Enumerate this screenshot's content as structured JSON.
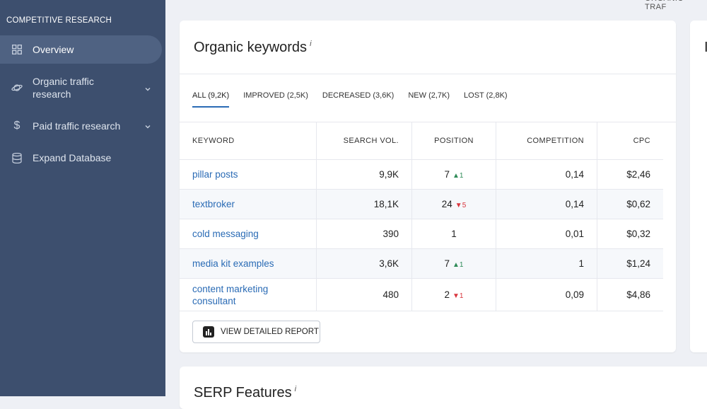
{
  "top_hint": "ORGANIC TRAF",
  "sidebar": {
    "section_title": "COMPETITIVE RESEARCH",
    "items": [
      {
        "label": "Overview",
        "icon": "grid-icon",
        "active": true
      },
      {
        "label": "Organic traffic research",
        "icon": "planet-icon",
        "chevron": true
      },
      {
        "label": "Paid traffic research",
        "icon": "dollar-icon",
        "chevron": true
      },
      {
        "label": "Expand Database",
        "icon": "database-icon"
      }
    ]
  },
  "keywords_card": {
    "title": "Organic keywords",
    "info": "i",
    "tabs": [
      {
        "label": "ALL (9,2K)",
        "active": true
      },
      {
        "label": "IMPROVED (2,5K)"
      },
      {
        "label": "DECREASED (3,6K)"
      },
      {
        "label": "NEW (2,7K)"
      },
      {
        "label": "LOST (2,8K)"
      }
    ],
    "columns": [
      "KEYWORD",
      "SEARCH VOL.",
      "POSITION",
      "COMPETITION",
      "CPC"
    ],
    "rows": [
      {
        "keyword": "pillar posts",
        "volume": "9,9K",
        "position": "7",
        "change": "1",
        "direction": "up",
        "competition": "0,14",
        "cpc": "$2,46"
      },
      {
        "keyword": "textbroker",
        "volume": "18,1K",
        "position": "24",
        "change": "5",
        "direction": "down",
        "competition": "0,14",
        "cpc": "$0,62"
      },
      {
        "keyword": "cold messaging",
        "volume": "390",
        "position": "1",
        "change": "",
        "direction": "",
        "competition": "0,01",
        "cpc": "$0,32"
      },
      {
        "keyword": "media kit examples",
        "volume": "3,6K",
        "position": "7",
        "change": "1",
        "direction": "up",
        "competition": "1",
        "cpc": "$1,24"
      },
      {
        "keyword": "content marketing consultant",
        "volume": "480",
        "position": "2",
        "change": "1",
        "direction": "down",
        "competition": "0,09",
        "cpc": "$4,86"
      }
    ],
    "report_button": "VIEW DETAILED REPORT"
  },
  "right_card": {
    "title_fragment": "I"
  },
  "serp_card": {
    "title": "SERP Features",
    "info": "i"
  },
  "colors": {
    "sidebar": "#3d4f6e",
    "link": "#2a6bb5",
    "up": "#2e8b57",
    "down": "#d9363e"
  }
}
